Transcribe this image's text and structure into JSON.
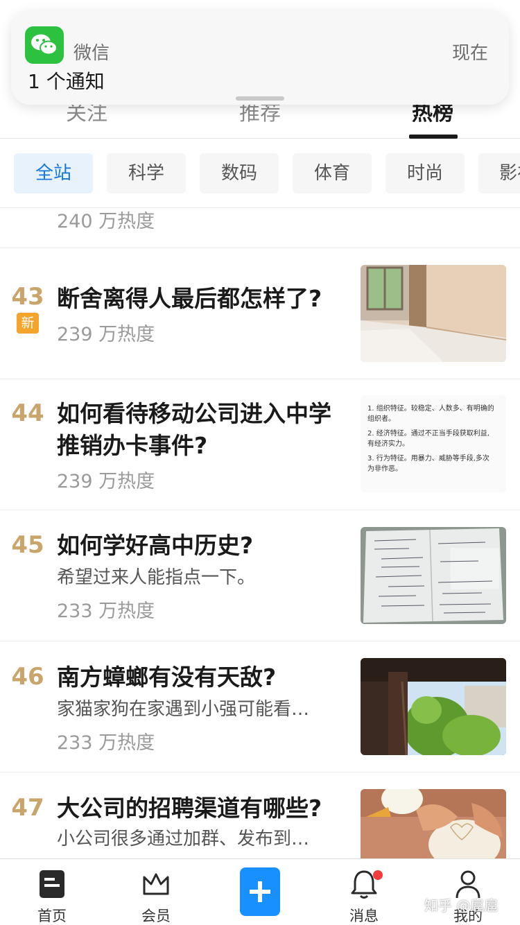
{
  "notification": {
    "app": "微信",
    "time": "现在",
    "body": "1 个通知"
  },
  "top_tabs": [
    "关注",
    "推荐",
    "热榜"
  ],
  "categories": [
    "全站",
    "科学",
    "数码",
    "体育",
    "时尚",
    "影视"
  ],
  "feed_top_heat": "240 万热度",
  "feed": [
    {
      "rank": "43",
      "badge": "新",
      "title": "断舍离得人最后都怎样了?",
      "excerpt": "",
      "heat": "239 万热度"
    },
    {
      "rank": "44",
      "title_line1": "如何看待移动公司进入中学",
      "title_line2": "推销办卡事件?",
      "heat": "239 万热度",
      "thumb_text": [
        "1. 组织特征。较稳定、人数多、有明确的",
        "组织者。",
        "2. 经济特征。通过不正当手段获取利益,",
        "有经济实力。",
        "3. 行为特征。用暴力、威胁等手段,多次",
        "为非作恶。"
      ]
    },
    {
      "rank": "45",
      "title": "如何学好高中历史?",
      "excerpt": "希望过来人能指点一下。",
      "heat": "233 万热度"
    },
    {
      "rank": "46",
      "title": "南方蟑螂有没有天敌?",
      "excerpt": "家猫家狗在家遇到小强可能看…",
      "heat": "233 万热度"
    },
    {
      "rank": "47",
      "title": "大公司的招聘渠道有哪些?",
      "excerpt": "小公司很多通过加群、发布到…"
    }
  ],
  "bottom_nav": {
    "home": "首页",
    "vip": "会员",
    "messages": "消息",
    "mine": "我的"
  },
  "watermark": "知乎 @扈扈",
  "colors": {
    "accent": "#1890ff",
    "rank": "#c9a56b",
    "new_badge": "#f4a42a",
    "wechat": "#2cc13f"
  }
}
